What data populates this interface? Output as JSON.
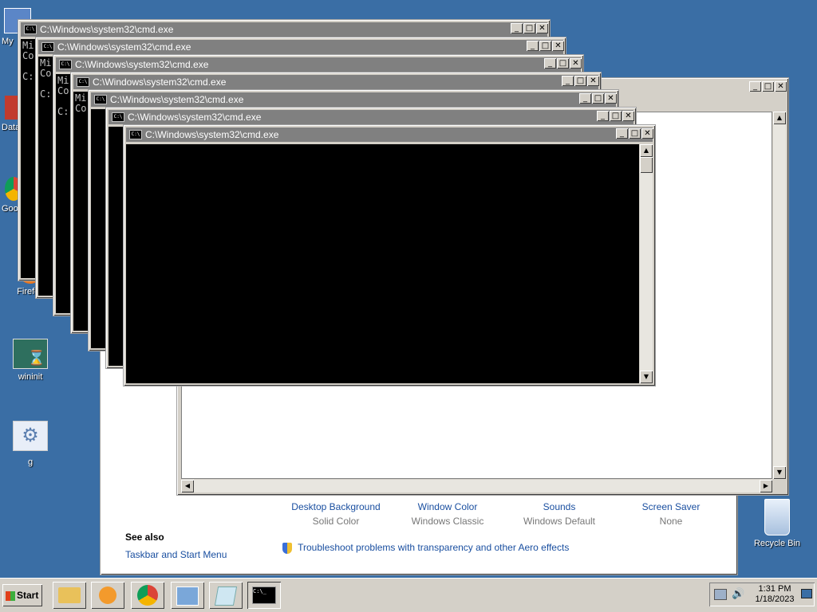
{
  "desktop": {
    "icons": [
      {
        "label": "My"
      },
      {
        "label": "Data"
      },
      {
        "label": "Goo"
      },
      {
        "label": "Firefox"
      },
      {
        "label": "wininit"
      },
      {
        "label": "g"
      },
      {
        "label": "Recycle Bin"
      }
    ]
  },
  "cmd_windows": {
    "title": "C:\\Windows\\system32\\cmd.exe",
    "icon_text": "C:\\",
    "line1": "Mi",
    "line2": "Co",
    "prompt": "C:"
  },
  "personalize": {
    "items": [
      {
        "title": "Desktop Background",
        "value": "Solid Color"
      },
      {
        "title": "Window Color",
        "value": "Windows Classic"
      },
      {
        "title": "Sounds",
        "value": "Windows Default"
      },
      {
        "title": "Screen Saver",
        "value": "None"
      }
    ],
    "see_also": "See also",
    "taskbar_link": "Taskbar and Start Menu",
    "troubleshoot": "Troubleshoot problems with transparency and other Aero effects"
  },
  "taskbar": {
    "start_label": "Start",
    "time": "1:31 PM",
    "date": "1/18/2023"
  },
  "colors": {
    "desktop": "#3a6ea5",
    "title_inactive": "#808080",
    "link": "#1a4fa0"
  }
}
